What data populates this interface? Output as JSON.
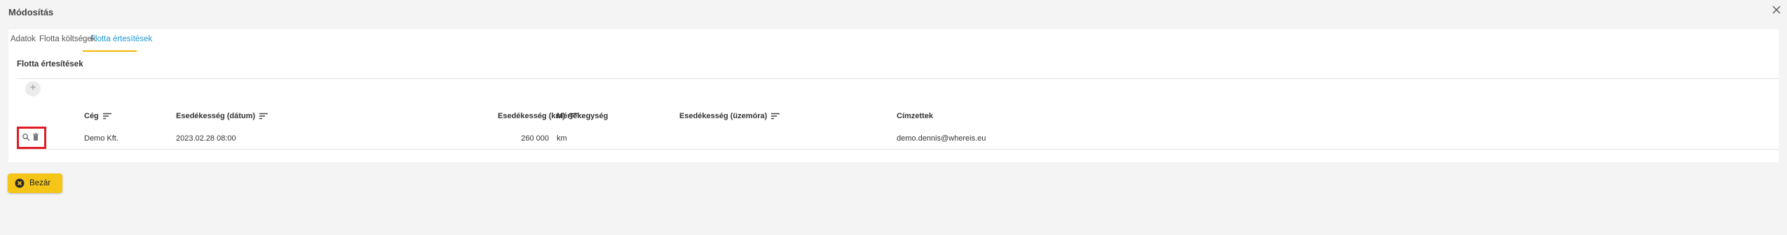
{
  "dialog": {
    "title": "Módosítás"
  },
  "tabs": [
    {
      "label": "Adatok"
    },
    {
      "label": "Flotta költségek"
    },
    {
      "label": "Flotta értesítések"
    }
  ],
  "section": {
    "title": "Flotta értesítések",
    "add_icon": "plus-icon"
  },
  "table": {
    "columns": {
      "ceg": "Cég",
      "esedekesseg_datum": "Esedékesség (dátum)",
      "esedekesseg_km": "Esedékesség (km)",
      "mertekegyseg": "Mértékegység",
      "esedekesseg_uzemora": "Esedékesség (üzemóra)",
      "cimzettek": "Címzettek"
    },
    "rows": [
      {
        "ceg": "Demo Kft.",
        "esedekesseg_datum": "2023.02.28 08:00",
        "esedekesseg_km": "260 000",
        "mertekegyseg": "km",
        "esedekesseg_uzemora": "",
        "cimzettek": "demo.dennis@whereis.eu"
      }
    ],
    "row_actions": [
      "search-icon",
      "trash-icon"
    ]
  },
  "footer": {
    "close_label": "Bezár"
  },
  "colors": {
    "accent": "#1a96d4",
    "tab_underline": "#f5b400",
    "button": "#f5c518",
    "highlight": "#e01b24"
  }
}
